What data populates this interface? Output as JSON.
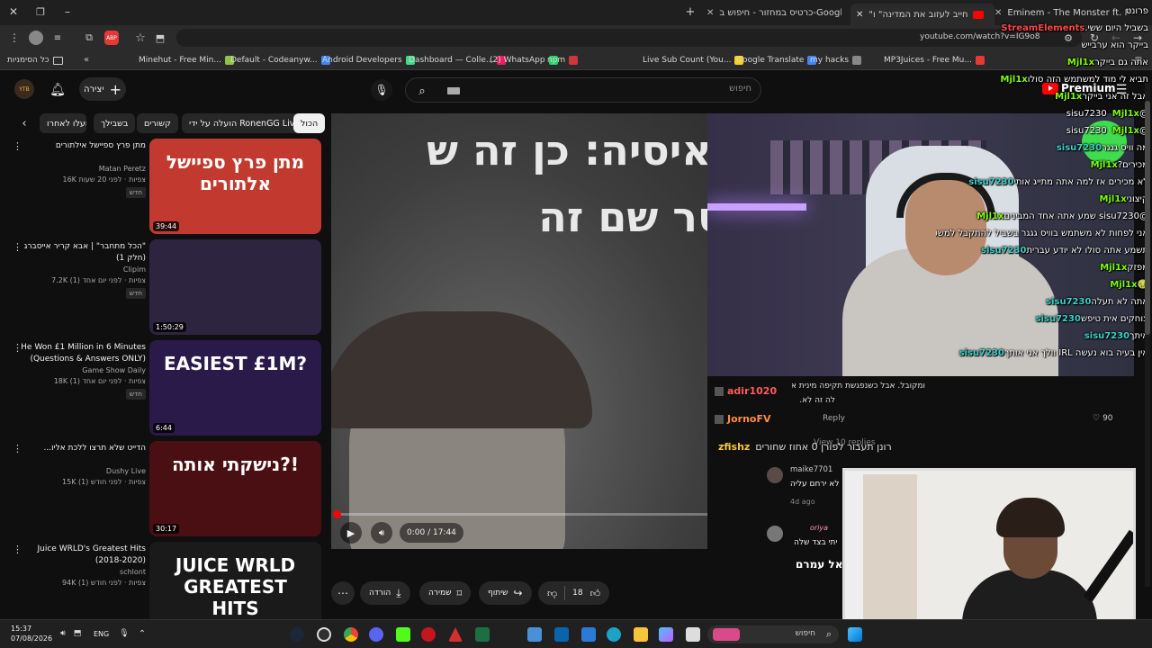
{
  "browser": {
    "tabs": [
      {
        "label": "Eminem - The Monster ft. Rihanna"
      },
      {
        "label": "\"אני חייב לעזוב את המדינה\" ו..."
      },
      {
        "label": "כרטיס במחזור - חיפוש ב-Google"
      }
    ],
    "url": "youtube.com/watch?v=IG9o8",
    "bookmarks": [
      {
        "label": "Minehut - Free Min...",
        "color": "#8bc34a"
      },
      {
        "label": "Default - Codeanyw...",
        "color": "#4285f4"
      },
      {
        "label": "Android Developers",
        "color": "#3ddc84"
      },
      {
        "label": "Dashboard — Colle...",
        "color": "#e91e63"
      },
      {
        "label": "(2) WhatsApp",
        "color": "#25d366"
      },
      {
        "label": "npm",
        "color": "#cb3837"
      },
      {
        "label": "Live Sub Count (You...",
        "color": "#f7d11d"
      },
      {
        "label": "Google Translate",
        "color": "#4285f4"
      },
      {
        "label": "my hacks",
        "color": "#888888"
      },
      {
        "label": "MP3Juices - Free Mu...",
        "color": "#e53935"
      }
    ],
    "all_bookmarks": "כל הסימניות"
  },
  "youtube": {
    "create_label": "יצירה",
    "search_placeholder": "חיפוש",
    "premium_label": "Premium",
    "chips": [
      "הכול",
      "הועלה על ידי RonenGG Live",
      "קשורים",
      "בשבילך",
      "הועלו לאחרו"
    ],
    "recommended": [
      {
        "title": "מתן פרץ ספיישל אילתורים",
        "channel": "Matan Peretz",
        "views": "16K צפיות · לפני 20 שעות",
        "badge": "חדש",
        "duration": "39:44",
        "thumb_text": "מתן פרץ ספיישל אלתורים",
        "thumb_bg": "#c23a2f"
      },
      {
        "title": "\"הכל מתחבר\" | אבא קריר אייסברג (חלק 1)",
        "channel": "Clipim",
        "views": "7.2K צפיות · לפני יום אחד (1)",
        "badge": "חדש",
        "duration": "1:50:29",
        "thumb_text": "",
        "thumb_bg": "#2d2540"
      },
      {
        "title": "He Won £1 Million in 6 Minutes (Questions & Answers ONLY)",
        "channel": "Game Show Daily",
        "views": "18K צפיות · לפני יום אחד (1)",
        "badge": "חדש",
        "duration": "6:44",
        "thumb_text": "EASIEST £1M?",
        "thumb_bg": "#2a1a4a"
      },
      {
        "title": "הדייט שלא תרצו ללכת אליו...",
        "channel": "Dushy Live",
        "views": "15K צפיות · לפני חודש (1)",
        "badge": "",
        "duration": "30:17",
        "thumb_text": "נישקתי אותה?!",
        "thumb_bg": "#4a0f12"
      },
      {
        "title": "Juice WRLD's Greatest Hits (2018-2020)",
        "channel": "schlont",
        "views": "94K צפיות · לפני חודש (1)",
        "badge": "",
        "duration": "",
        "thumb_text": "JUICE WRLD GREATEST HITS",
        "thumb_bg": "#1a1a1a"
      }
    ],
    "player": {
      "overlay_line1": "טאיסיה: כן זה ש",
      "overlay_line2": "וסר שם זה",
      "time": "0:00 / 17:44",
      "progress": 0.0
    },
    "video_title_fragment": "אל עמרם",
    "actions": {
      "likes": "18",
      "share": "שיתוף",
      "save": "שמירה",
      "download": "הורדה"
    }
  },
  "comments": {
    "top_text": "ומקובל. אבל כשנפגשת תקיפה מינית או ניצול מיני רוצה כסף על העוול והנזק שנגרם לה זה לא בסדר",
    "top_text2": "לה זה לא.",
    "reply_label": "Reply",
    "likes": "90",
    "view_replies": "View 10 replies",
    "items": [
      {
        "user": "adir1020",
        "color": "#ff5a5a"
      },
      {
        "user": "JornoFV",
        "color": "#ff8c42"
      },
      {
        "user": "zfishz",
        "text": "רונן תעבור לפורן 0 אחוז שחורים",
        "color": "#f5c542"
      }
    ],
    "reply": {
      "user": "maike7701",
      "text": "לא ירחם עליה",
      "time": "4d ago",
      "reply_label": "Reply"
    },
    "reply2": {
      "user": "oriya",
      "text": "יתי בצד שלה"
    }
  },
  "chat": [
    {
      "user": "",
      "text": "פרונט",
      "color": "#ffffff"
    },
    {
      "user": "StreamElements",
      "text": "בשביל היום ששי.",
      "color": "#ff4444"
    },
    {
      "user": "",
      "text": "בייקר הוא ערבייש",
      "color": "#ffffff"
    },
    {
      "user": "Mjl1x",
      "text": "אתה גם בייקר",
      "color": "#7cfc00"
    },
    {
      "user": "Mjl1x",
      "text": "תביא לי מוד למשתמש הזה סולו",
      "color": "#7cfc00"
    },
    {
      "user": "Mjl1x",
      "text": "אבל זה אני בייקר",
      "color": "#7cfc00"
    },
    {
      "user": "Mjl1x",
      "text": "@sisu7230",
      "color": "#7cfc00"
    },
    {
      "user": "Mjl1x",
      "text": "@sisu7230",
      "color": "#7cfc00"
    },
    {
      "user": "sisu7230",
      "text": "מה וויס גגגר",
      "color": "#3ad1c8"
    },
    {
      "user": "Mjl1x",
      "text": "מכירים?",
      "color": "#7cfc00"
    },
    {
      "user": "sisu7230",
      "text": "לא מכירים אז למה אתה מתייג אותי",
      "color": "#3ad1c8"
    },
    {
      "user": "Mjl1x",
      "text": "קיצוני",
      "color": "#7cfc00"
    },
    {
      "user": "Mjl1x",
      "text": "@sisu7230 שמע אתה אחד המבינים",
      "color": "#7cfc00"
    },
    {
      "user": "sisu7230",
      "text": "אני לפחות לא משתמש בוויס גגגר בשביל להתקבל למשטרה ב PR",
      "color": "#3ad1c8"
    },
    {
      "user": "sisu7230",
      "text": "תשמע אתה סולו לא יודע עברית",
      "color": "#3ad1c8"
    },
    {
      "user": "Mjl1x",
      "text": "מפזק",
      "color": "#7cfc00"
    },
    {
      "user": "Mjl1x",
      "text": "🤢",
      "color": "#7cfc00"
    },
    {
      "user": "sisu7230",
      "text": "אתה לא תעלה",
      "color": "#3ad1c8"
    },
    {
      "user": "sisu7230",
      "text": "צוחקים אית טיפש",
      "color": "#3ad1c8"
    },
    {
      "user": "sisu7230",
      "text": "איתך",
      "color": "#3ad1c8"
    },
    {
      "user": "sisu7230",
      "text": "אין בעיה בוא נעשה IRL וולך אני אותך",
      "color": "#3ad1c8"
    }
  ],
  "taskbar": {
    "time": "15:37",
    "date": "07/08/2026",
    "lang": "ENG",
    "search_label": "חיפוש"
  }
}
